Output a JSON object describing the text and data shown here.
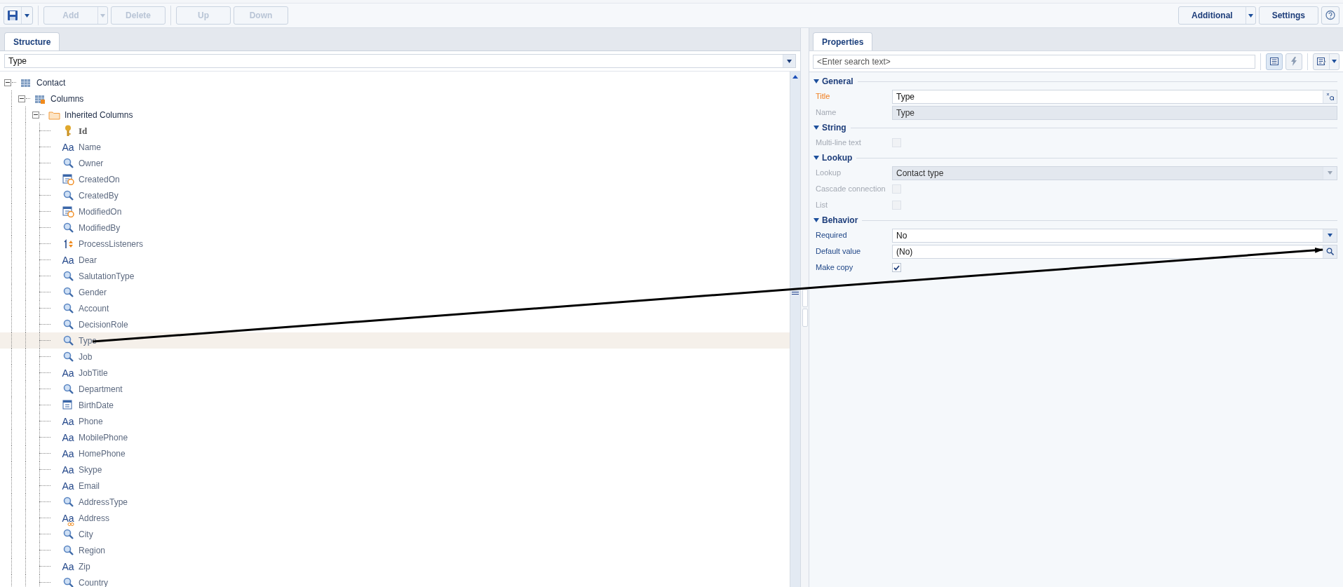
{
  "toolbar": {
    "left": [
      {
        "kind": "save",
        "disabled": false,
        "has_menu": true
      },
      {
        "kind": "button",
        "label": "Add",
        "disabled": true,
        "has_menu": true
      },
      {
        "kind": "button",
        "label": "Delete",
        "disabled": true,
        "has_menu": false
      },
      {
        "kind": "button",
        "label": "Up",
        "disabled": true,
        "has_menu": false
      },
      {
        "kind": "button",
        "label": "Down",
        "disabled": true,
        "has_menu": false
      }
    ],
    "right": [
      {
        "kind": "button",
        "label": "Additional",
        "disabled": false,
        "has_menu": true
      },
      {
        "kind": "button",
        "label": "Settings",
        "disabled": false,
        "has_menu": false
      },
      {
        "kind": "help",
        "disabled": false
      }
    ]
  },
  "structure": {
    "tab": {
      "label": "Structure",
      "selected": true
    },
    "filter": {
      "value": "Type"
    },
    "tree": [
      {
        "label": "Contact",
        "kind": "object",
        "expanded": true,
        "selected": false,
        "children": [
          {
            "label": "Columns",
            "kind": "columns",
            "expanded": true,
            "selected": false,
            "children": [
              {
                "label": "Inherited Columns",
                "kind": "folder",
                "expanded": true,
                "selected": false,
                "children": [
                  {
                    "label": "Id",
                    "kind": "key",
                    "selected": false
                  },
                  {
                    "label": "Name",
                    "kind": "text",
                    "glyph": "Aa",
                    "selected": false
                  },
                  {
                    "label": "Owner",
                    "kind": "lookup",
                    "selected": false
                  },
                  {
                    "label": "CreatedOn",
                    "kind": "datetime",
                    "selected": false
                  },
                  {
                    "label": "CreatedBy",
                    "kind": "lookup",
                    "selected": false
                  },
                  {
                    "label": "ModifiedOn",
                    "kind": "datetime",
                    "selected": false
                  },
                  {
                    "label": "ModifiedBy",
                    "kind": "lookup",
                    "selected": false
                  },
                  {
                    "label": "ProcessListeners",
                    "kind": "integer",
                    "selected": false
                  },
                  {
                    "label": "Dear",
                    "kind": "text",
                    "glyph": "Aa",
                    "selected": false
                  },
                  {
                    "label": "SalutationType",
                    "kind": "lookup",
                    "selected": false
                  },
                  {
                    "label": "Gender",
                    "kind": "lookup",
                    "selected": false
                  },
                  {
                    "label": "Account",
                    "kind": "lookup",
                    "selected": false
                  },
                  {
                    "label": "DecisionRole",
                    "kind": "lookup",
                    "selected": false
                  },
                  {
                    "label": "Type",
                    "kind": "lookup",
                    "selected": true
                  },
                  {
                    "label": "Job",
                    "kind": "lookup",
                    "selected": false
                  },
                  {
                    "label": "JobTitle",
                    "kind": "text",
                    "glyph": "Aa",
                    "selected": false
                  },
                  {
                    "label": "Department",
                    "kind": "lookup",
                    "selected": false
                  },
                  {
                    "label": "BirthDate",
                    "kind": "date",
                    "selected": false
                  },
                  {
                    "label": "Phone",
                    "kind": "text",
                    "glyph": "Aa",
                    "selected": false
                  },
                  {
                    "label": "MobilePhone",
                    "kind": "text",
                    "glyph": "Aa",
                    "selected": false
                  },
                  {
                    "label": "HomePhone",
                    "kind": "text",
                    "glyph": "Aa",
                    "selected": false
                  },
                  {
                    "label": "Skype",
                    "kind": "text",
                    "glyph": "Aa",
                    "selected": false
                  },
                  {
                    "label": "Email",
                    "kind": "text",
                    "glyph": "Aa",
                    "selected": false
                  },
                  {
                    "label": "AddressType",
                    "kind": "lookup",
                    "selected": false
                  },
                  {
                    "label": "Address",
                    "kind": "multitext",
                    "glyph": "Aa",
                    "selected": false
                  },
                  {
                    "label": "City",
                    "kind": "lookup",
                    "selected": false
                  },
                  {
                    "label": "Region",
                    "kind": "lookup",
                    "selected": false
                  },
                  {
                    "label": "Zip",
                    "kind": "text",
                    "glyph": "Aa",
                    "selected": false
                  },
                  {
                    "label": "Country",
                    "kind": "lookup",
                    "selected": false
                  }
                ]
              }
            ]
          }
        ]
      }
    ]
  },
  "properties": {
    "tab": {
      "label": "Properties",
      "selected": true
    },
    "search": {
      "placeholder": "<Enter search text>"
    },
    "groups": [
      {
        "name": "General",
        "expanded": true,
        "rows": [
          {
            "label": "Title",
            "kind": "translatable",
            "value": "Type",
            "disabled": false,
            "highlighted": true
          },
          {
            "label": "Name",
            "kind": "readonly",
            "value": "Type",
            "disabled": true,
            "highlighted": false
          }
        ]
      },
      {
        "name": "String",
        "expanded": true,
        "rows": [
          {
            "label": "Multi-line text",
            "kind": "checkbox",
            "checked": false,
            "disabled": true,
            "highlighted": false
          }
        ]
      },
      {
        "name": "Lookup",
        "expanded": true,
        "rows": [
          {
            "label": "Lookup",
            "kind": "select",
            "value": "Contact type",
            "disabled": true,
            "highlighted": false
          },
          {
            "label": "Cascade connection",
            "kind": "checkbox",
            "checked": false,
            "disabled": true,
            "highlighted": false
          },
          {
            "label": "List",
            "kind": "checkbox",
            "checked": false,
            "disabled": true,
            "highlighted": false
          }
        ]
      },
      {
        "name": "Behavior",
        "expanded": true,
        "rows": [
          {
            "label": "Required",
            "kind": "select",
            "value": "No",
            "disabled": false,
            "highlighted": false
          },
          {
            "label": "Default value",
            "kind": "lookup",
            "value": "(No)",
            "disabled": false,
            "highlighted": false
          },
          {
            "label": "Make copy",
            "kind": "checkbox",
            "checked": true,
            "disabled": false,
            "highlighted": false
          }
        ]
      }
    ]
  }
}
